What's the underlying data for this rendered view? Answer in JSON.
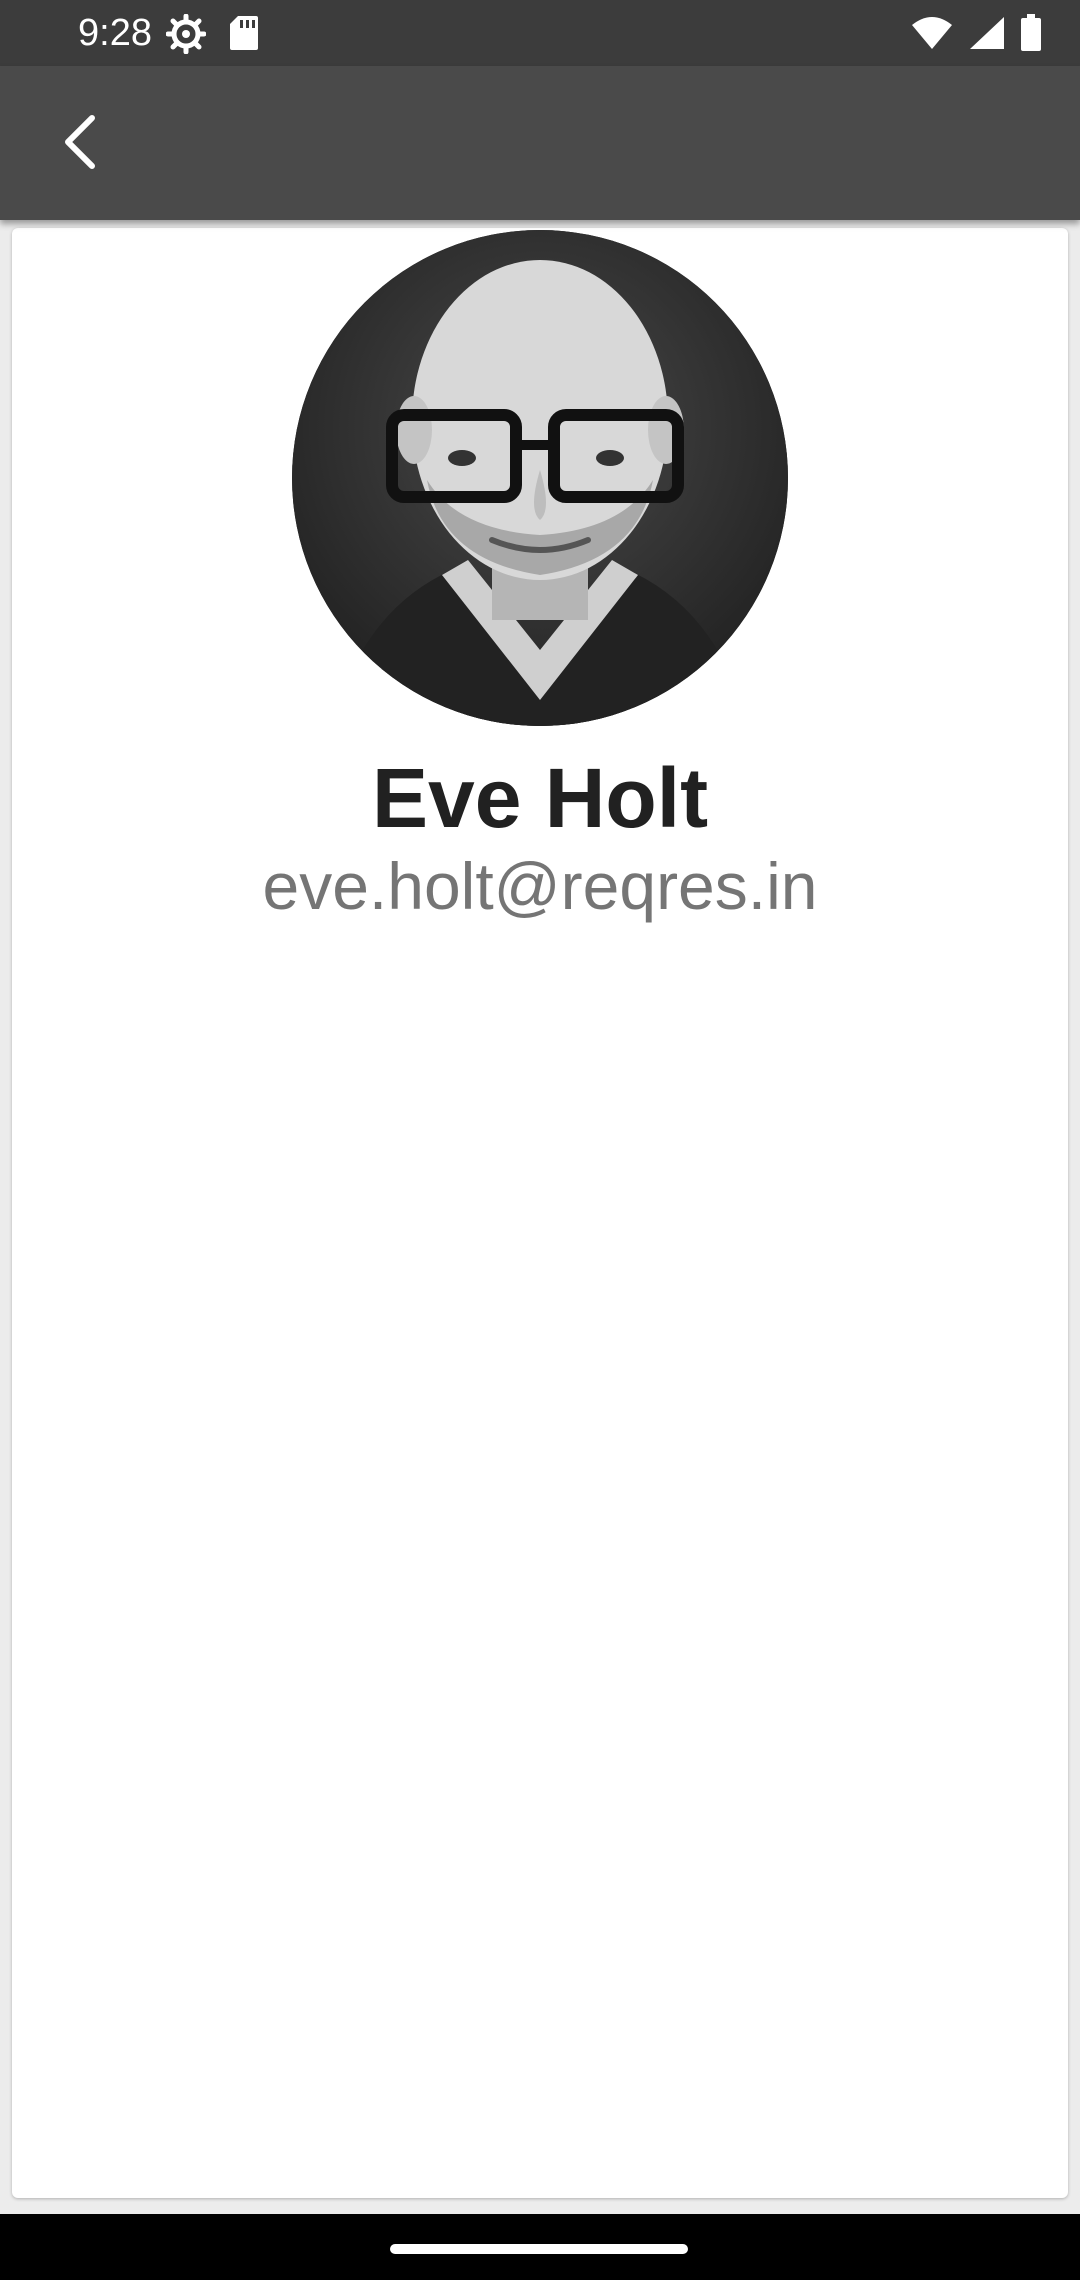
{
  "status_bar": {
    "time": "9:28",
    "left_icons": [
      "settings-icon",
      "sd-card-icon"
    ],
    "right_icons": [
      "wifi-icon",
      "signal-icon",
      "battery-icon"
    ]
  },
  "app_bar": {
    "back_icon": "chevron-left-icon"
  },
  "profile": {
    "name": "Eve Holt",
    "email": "eve.holt@reqres.in",
    "avatar": "profile-photo"
  },
  "colors": {
    "status_bar": "#3c3c3c",
    "app_bar": "#4a4a4a",
    "card": "#ffffff",
    "name_text": "#212121",
    "email_text": "#757575",
    "nav_bar": "#000000"
  }
}
